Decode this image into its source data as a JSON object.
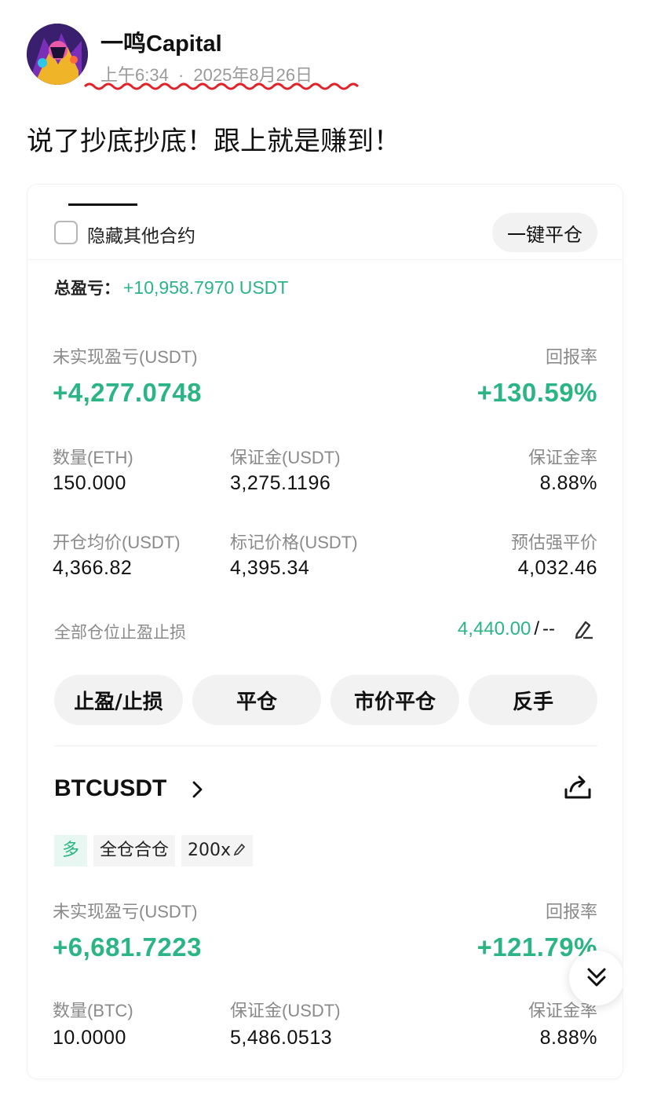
{
  "post": {
    "author": "一鸣Capital",
    "time": "上午6:34",
    "date_sep": "·",
    "date": "2025年8月26日",
    "text": "说了抄底抄底！跟上就是赚到！"
  },
  "card": {
    "hide_others_label": "隐藏其他合约",
    "hide_others_checked": false,
    "close_all_button": "一键平仓",
    "total_pnl_label": "总盈亏：",
    "total_pnl_value": "+10,958.7970 USDT",
    "position1": {
      "unrealized_label": "未实现盈亏(USDT)",
      "unrealized_value": "+4,277.0748",
      "roe_label": "回报率",
      "roe_value": "+130.59%",
      "qty_label": "数量(ETH)",
      "qty_value": "150.000",
      "margin_label": "保证金(USDT)",
      "margin_value": "3,275.1196",
      "margin_ratio_label": "保证金率",
      "margin_ratio_value": "8.88%",
      "entry_label": "开仓均价(USDT)",
      "entry_value": "4,366.82",
      "mark_label": "标记价格(USDT)",
      "mark_value": "4,395.34",
      "liq_label": "预估强平价",
      "liq_value": "4,032.46",
      "tpsl_label": "全部仓位止盈止损",
      "tp_value": "4,440.00",
      "sl_sep": "/",
      "sl_value": "--"
    },
    "actions": [
      "止盈/止损",
      "平仓",
      "市价平仓",
      "反手"
    ],
    "position2": {
      "symbol": "BTCUSDT",
      "tag_side": "多",
      "tag_mode": "全仓合仓",
      "tag_leverage": "200x",
      "unrealized_label": "未实现盈亏(USDT)",
      "unrealized_value": "+6,681.7223",
      "roe_label": "回报率",
      "roe_value": "+121.79%",
      "qty_label": "数量(BTC)",
      "qty_value": "10.0000",
      "margin_label": "保证金(USDT)",
      "margin_value": "5,486.0513",
      "margin_ratio_label": "保证金率",
      "margin_ratio_value": "8.88%"
    }
  },
  "colors": {
    "profit_green": "#2bb585",
    "label_gray": "#8a8a8a",
    "button_bg": "#f2f2f2",
    "squiggle_red": "#e0232b"
  },
  "icons": [
    "checkbox-icon",
    "edit-icon",
    "chevron-right-icon",
    "share-icon",
    "double-chevron-down-icon"
  ]
}
